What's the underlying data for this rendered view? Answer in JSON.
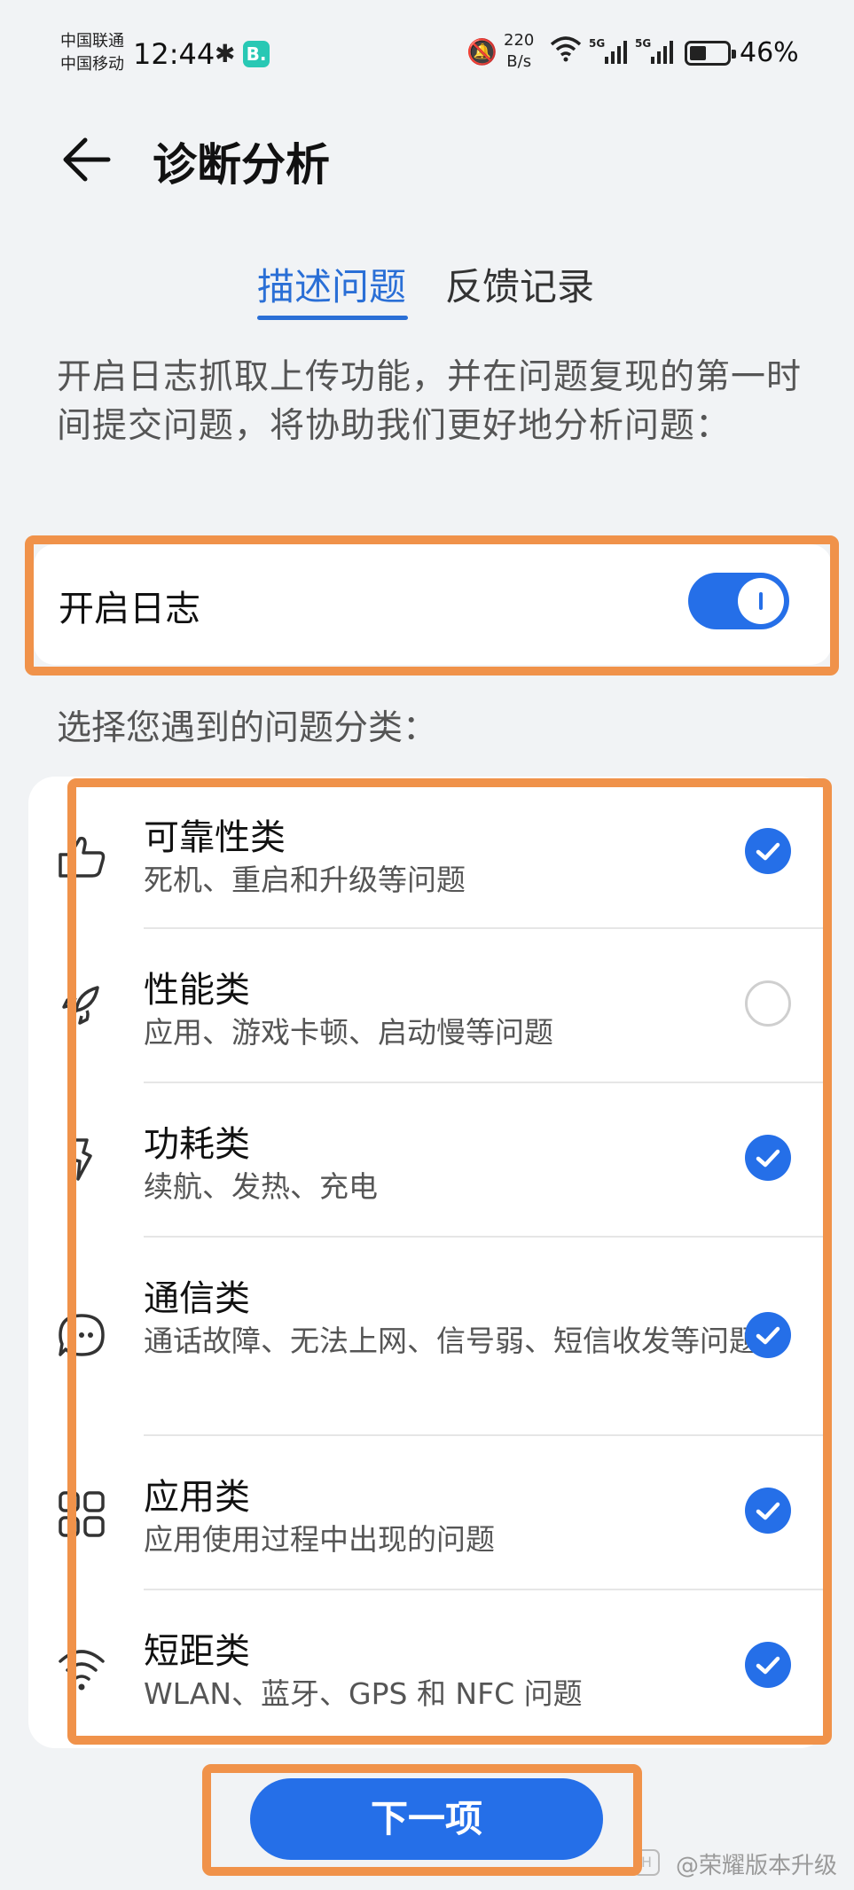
{
  "status_bar": {
    "carrier_1": "中国联通",
    "carrier_2": "中国移动",
    "time": "12:44",
    "app_badge": "B.",
    "speed_value": "220",
    "speed_unit": "B/s",
    "sig1_label": "5G",
    "sig2_label": "5G",
    "battery_percent": "46%",
    "battery_level": 0.46
  },
  "header": {
    "title": "诊断分析"
  },
  "tabs": [
    {
      "label": "描述问题",
      "active": true
    },
    {
      "label": "反馈记录",
      "active": false
    }
  ],
  "intro_text": "开启日志抓取上传功能，并在问题复现的第一时间提交问题，将协助我们更好地分析问题：",
  "log_toggle": {
    "label": "开启日志",
    "enabled": true
  },
  "category_prompt": "选择您遇到的问题分类：",
  "categories": [
    {
      "title": "可靠性类",
      "desc": "死机、重启和升级等问题",
      "icon": "thumbs-up-icon",
      "checked": true
    },
    {
      "title": "性能类",
      "desc": "应用、游戏卡顿、启动慢等问题",
      "icon": "rocket-icon",
      "checked": false
    },
    {
      "title": "功耗类",
      "desc": "续航、发热、充电",
      "icon": "power-icon",
      "checked": true
    },
    {
      "title": "通信类",
      "desc": "通话故障、无法上网、信号弱、短信收发等问题",
      "icon": "chat-bubble-icon",
      "checked": true
    },
    {
      "title": "应用类",
      "desc": "应用使用过程中出现的问题",
      "icon": "apps-grid-icon",
      "checked": true
    },
    {
      "title": "短距类",
      "desc": "WLAN、蓝牙、GPS 和 NFC 问题",
      "icon": "wifi-icon",
      "checked": true
    }
  ],
  "next_button": "下一项",
  "watermark": "@荣耀版本升级",
  "colors": {
    "accent": "#256fe8",
    "tab_active": "#2a6fd6",
    "highlight": "#f0924a",
    "background": "#f1f3f5"
  }
}
